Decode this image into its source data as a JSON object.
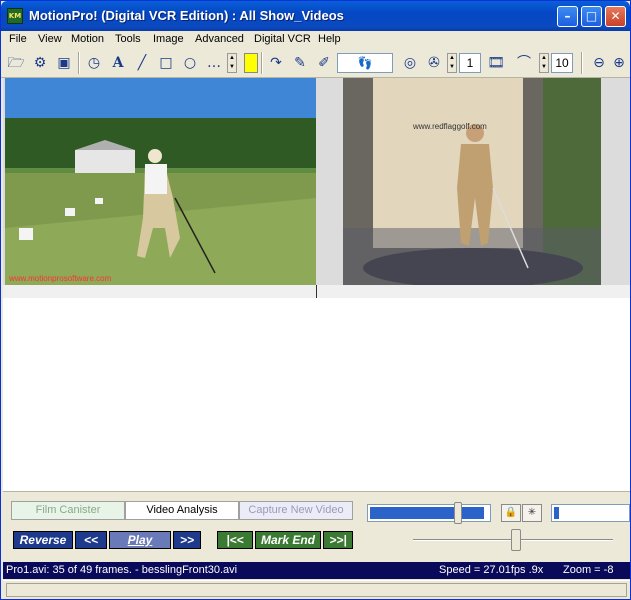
{
  "window": {
    "title": "MotionPro! (Digital VCR Edition) : All Show_Videos",
    "app_icon_label": "KM",
    "controls": {
      "minimize": "–",
      "maximize": "□",
      "close": "✕"
    }
  },
  "menu": [
    {
      "label": "File",
      "key": "file"
    },
    {
      "label": "View",
      "key": "view"
    },
    {
      "label": "Motion",
      "key": "motion"
    },
    {
      "label": "Tools",
      "key": "tools"
    },
    {
      "label": "Image",
      "key": "image"
    },
    {
      "label": "Advanced",
      "key": "advanced"
    },
    {
      "label": "Digital VCR",
      "key": "digital-vcr"
    },
    {
      "label": "Help",
      "key": "help"
    }
  ],
  "toolbar": {
    "icons": [
      "open-folder-icon",
      "properties-icon",
      "compare-icon",
      "stopwatch-icon",
      "text-icon",
      "line-icon",
      "rectangle-icon",
      "circle-icon",
      "dotted-line-icon",
      "color-swatch",
      "redo-arrow-icon",
      "pen-icon",
      "double-pen-icon",
      "footsteps-icon",
      "spiral-icon",
      "film-reel-icon",
      "filmstrip-icon",
      "arc-tool-icon",
      "zoom-out-icon",
      "zoom-in-icon"
    ],
    "frame_step_value": "1",
    "trail_value": "10",
    "highlight_color": "#ffff00"
  },
  "video": {
    "left_watermark": "www.motionprosoftware.com",
    "right_watermark": "www.redflaggolf.com"
  },
  "tabs": [
    {
      "label": "Film Canister",
      "active": false
    },
    {
      "label": "Video Analysis",
      "active": true
    },
    {
      "label": "Capture New Video",
      "active": false
    }
  ],
  "vcr": {
    "reverse": "Reverse",
    "rewind": "<<",
    "play": "Play",
    "forward": ">>",
    "to_start": "|<<",
    "mark_end": "Mark End",
    "to_end": ">>|"
  },
  "progress": {
    "left_bar_fraction": 0.95,
    "left_thumb_fraction": 0.72,
    "right_bar_fraction": 0.06,
    "speed_slider_fraction": 0.5
  },
  "status": {
    "file_info": "Pro1.avi:  35 of 49 frames. - besslingFront30.avi",
    "speed": "Speed = 27.01fps  .9x",
    "zoom": "Zoom = -8"
  }
}
